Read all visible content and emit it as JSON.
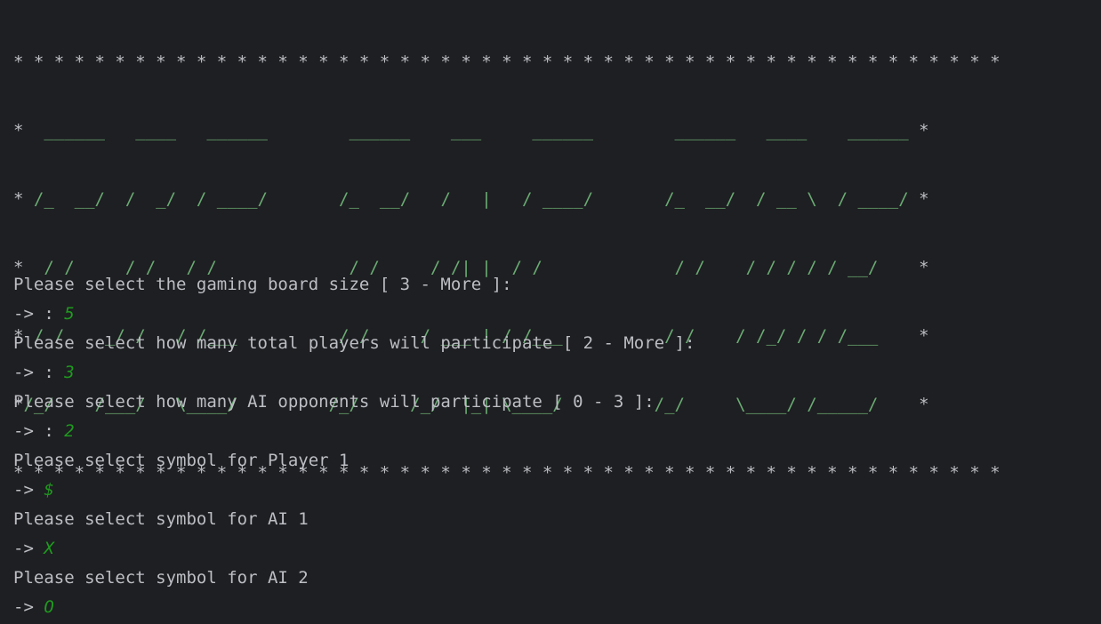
{
  "banner": {
    "border_top": "* * * * * * * * * * * * * * * * * * * * * * * * * * * * * * * * * * * * * * * * * * * * * * * * *",
    "rows": [
      {
        "left": "*",
        "art": "  ______   ____   ______        ______    ___     ______        ______   ____    ______ ",
        "right": "*"
      },
      {
        "left": "*",
        "art": " /_  __/  /  _/  / ____/       /_  __/   /   |   / ____/       /_  __/  / __ \\  / ____/ ",
        "right": "*"
      },
      {
        "left": "*",
        "art": "  / /     / /   / /             / /     / /| |  / /             / /    / / / / / __/    ",
        "right": "*"
      },
      {
        "left": "*",
        "art": " / /    _/ /   / /___          / /     / ___ | / /___          / /    / /_/ / / /___    ",
        "right": "*"
      },
      {
        "left": "*",
        "art": "/_/    /___/   \\____/         /_/     /_/  |_| \\____/         /_/     \\____/ /_____/    ",
        "right": "*"
      }
    ],
    "border_bottom": "* * * * * * * * * * * * * * * * * * * * * * * * * * * * * * * * * * * * * * * * * * * * * * * * *"
  },
  "session": [
    {
      "prompt": "Please select the gaming board size [ 3 - More ]:",
      "input": ""
    },
    {
      "prompt": "-> : ",
      "input": "5"
    },
    {
      "prompt": "Please select how many total players will participate [ 2 - More ]:",
      "input": ""
    },
    {
      "prompt": "-> : ",
      "input": "3"
    },
    {
      "prompt": "Please select how many AI opponents will participate [ 0 - 3 ]:",
      "input": ""
    },
    {
      "prompt": "-> : ",
      "input": "2"
    },
    {
      "prompt": "Please select symbol for Player 1",
      "input": ""
    },
    {
      "prompt": "-> ",
      "input": "$"
    },
    {
      "prompt": "Please select symbol for AI 1",
      "input": ""
    },
    {
      "prompt": "-> ",
      "input": "X"
    },
    {
      "prompt": "Please select symbol for AI 2",
      "input": ""
    },
    {
      "prompt": "-> ",
      "input": "O"
    }
  ],
  "colors": {
    "background": "#1e1f22",
    "text": "#bcbec4",
    "ascii_art": "#6aab73",
    "user_input": "#1f9a1f"
  }
}
